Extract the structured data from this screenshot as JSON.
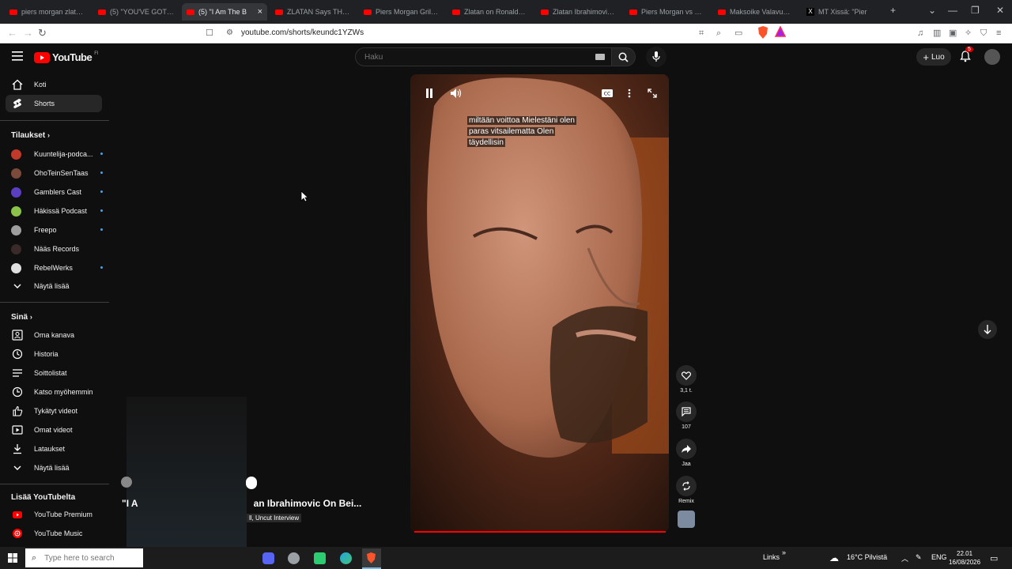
{
  "browser": {
    "tabs": [
      {
        "label": "piers morgan zlatan ib",
        "icon": "youtube-icon",
        "active": false
      },
      {
        "label": "(5) \"YOU'VE GOT TO B",
        "icon": "youtube-icon",
        "active": false
      },
      {
        "label": "(5) \"I Am The B",
        "icon": "youtube-icon",
        "active": true
      },
      {
        "label": "ZLATAN Says THIS Ab",
        "icon": "youtube-icon",
        "active": false
      },
      {
        "label": "Piers Morgan Grills Zl",
        "icon": "youtube-icon",
        "active": false
      },
      {
        "label": "Zlatan on Ronaldo an",
        "icon": "youtube-icon",
        "active": false
      },
      {
        "label": "Zlatan Ibrahimovic in",
        "icon": "youtube-icon",
        "active": false
      },
      {
        "label": "Piers Morgan vs Zlat",
        "icon": "youtube-icon",
        "active": false
      },
      {
        "label": "Maksoike Valavuori j",
        "icon": "youtube-icon",
        "active": false
      },
      {
        "label": "MT Xissä: \"Pier",
        "icon": "x-icon",
        "active": false
      }
    ],
    "url": "youtube.com/shorts/keundc1YZWs"
  },
  "youtube": {
    "logo": "YouTube",
    "logo_country": "FI",
    "search_placeholder": "Haku",
    "create_label": "Luo",
    "notifications_count": "5"
  },
  "sidebar": {
    "main": [
      {
        "label": "Koti",
        "icon": "home-icon"
      },
      {
        "label": "Shorts",
        "icon": "shorts-icon",
        "active": true
      }
    ],
    "subscriptions_title": "Tilaukset",
    "subscriptions": [
      {
        "label": "Kuuntelija-podca...",
        "color": "#c0392b"
      },
      {
        "label": "OhoTeinSenTaas",
        "color": "#7a4a3a"
      },
      {
        "label": "Gamblers Cast",
        "color": "#5a3fc0"
      },
      {
        "label": "Häkissä Podcast",
        "color": "#8bc34a"
      },
      {
        "label": "Freepo",
        "color": "#9e9e9e"
      },
      {
        "label": "Nääs Records",
        "color": "#3a2a2a"
      },
      {
        "label": "RebelWerks",
        "color": "#e0e0e0"
      }
    ],
    "show_more_1": "Näytä lisää",
    "you_title": "Sinä",
    "you": [
      {
        "label": "Oma kanava",
        "icon": "channel-icon"
      },
      {
        "label": "Historia",
        "icon": "history-icon"
      },
      {
        "label": "Soittolistat",
        "icon": "playlists-icon"
      },
      {
        "label": "Katso myöhemmin",
        "icon": "watch-later-icon"
      },
      {
        "label": "Tykätyt videot",
        "icon": "like-icon"
      },
      {
        "label": "Omat videot",
        "icon": "my-videos-icon"
      },
      {
        "label": "Lataukset",
        "icon": "download-icon"
      }
    ],
    "show_more_2": "Näytä lisää",
    "more_title": "Lisää YouTubelta",
    "more": [
      {
        "label": "YouTube Premium",
        "icon": "youtube-premium-icon"
      },
      {
        "label": "YouTube Music",
        "icon": "youtube-music-icon"
      }
    ]
  },
  "player": {
    "caption_lines": [
      "miltään voittoa Mielestäni olen",
      "paras vitsailematta Olen",
      "täydellisin"
    ],
    "actions": [
      {
        "label": "3,1 t.",
        "icon": "like-icon"
      },
      {
        "label": "107",
        "icon": "comment-icon"
      },
      {
        "label": "Jaa",
        "icon": "share-icon"
      },
      {
        "label": "Remix",
        "icon": "remix-icon"
      }
    ]
  },
  "miniplayer": {
    "title": "\"I Am ... an Ibrahimovic On Bei...",
    "title_left": "\"I A",
    "title_right": "an Ibrahimovic On Bei...",
    "channel": "ll, Uncut Interview"
  },
  "taskbar": {
    "search_placeholder": "Type here to search",
    "links": "Links",
    "weather": "16°C  Pilvistä",
    "language": "ENG",
    "time": "22.01",
    "date": "16/08/2026"
  }
}
